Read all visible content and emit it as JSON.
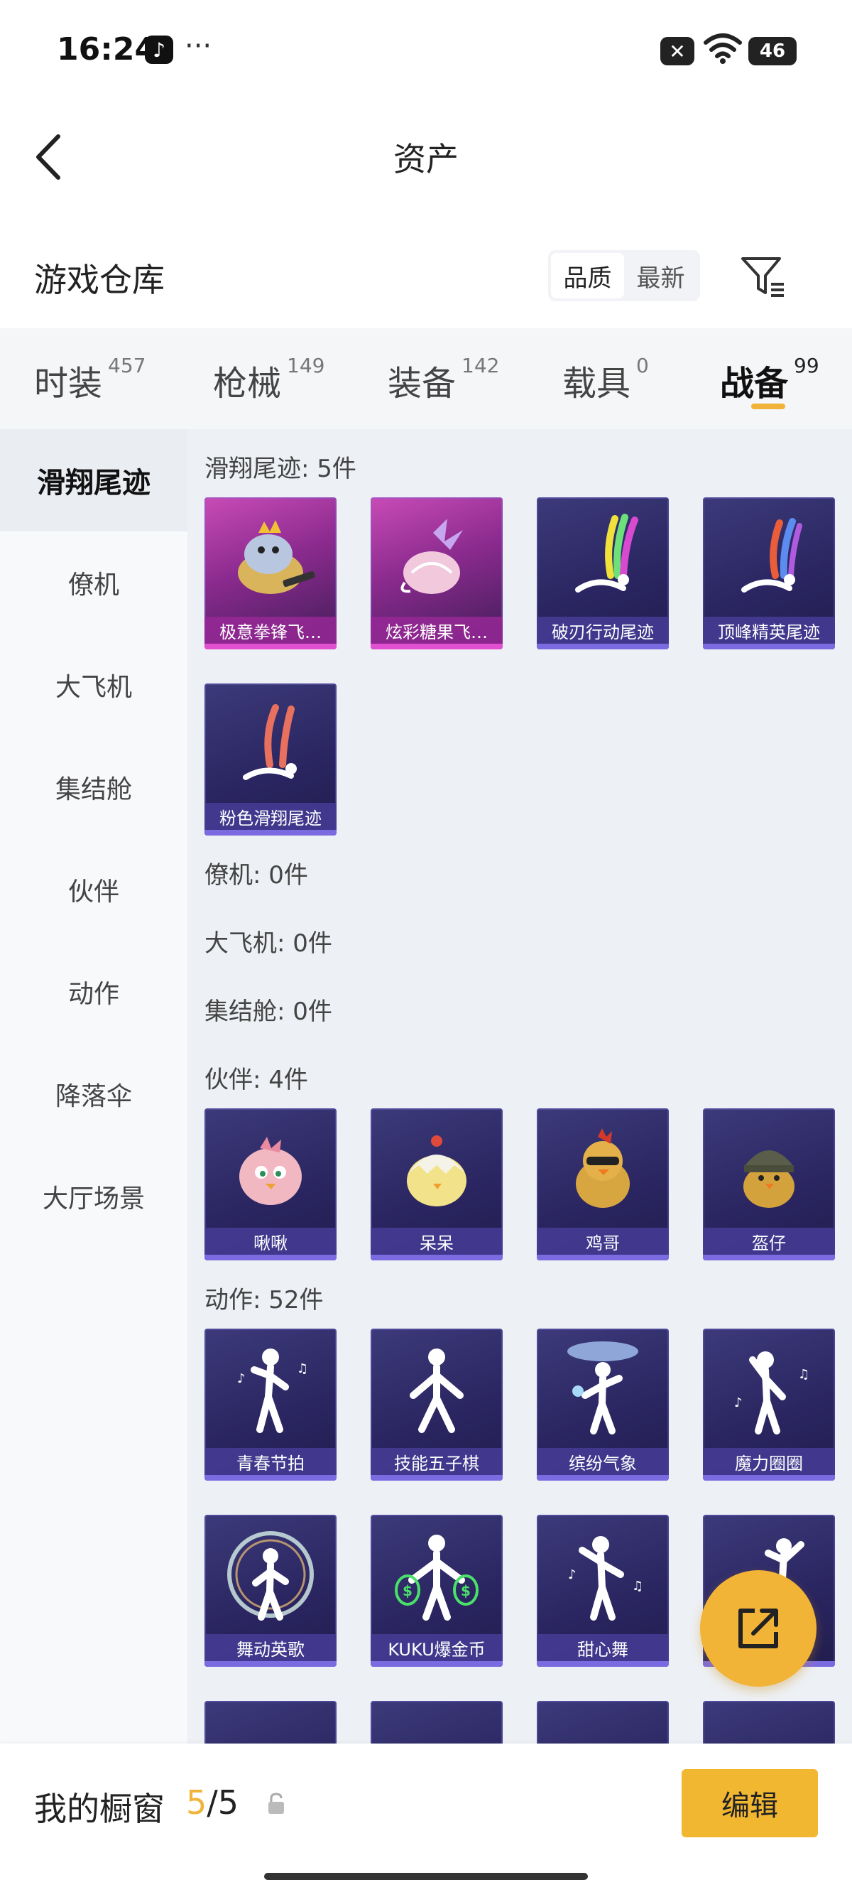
{
  "status": {
    "time": "16:24",
    "battery": "46"
  },
  "header": {
    "title": "资产"
  },
  "warehouse": {
    "title": "游戏仓库",
    "sort_options": [
      "品质",
      "最新"
    ],
    "selected_sort": "品质"
  },
  "tabs": [
    {
      "label": "时装",
      "count": "457"
    },
    {
      "label": "枪械",
      "count": "149"
    },
    {
      "label": "装备",
      "count": "142"
    },
    {
      "label": "载具",
      "count": "0"
    },
    {
      "label": "战备",
      "count": "99",
      "active": true
    }
  ],
  "sidebar": {
    "items": [
      "滑翔尾迹",
      "僚机",
      "大飞机",
      "集结舱",
      "伙伴",
      "动作",
      "降落伞",
      "大厅场景"
    ],
    "selected": "滑翔尾迹"
  },
  "sections": {
    "glide": {
      "title": "滑翔尾迹: 5件",
      "items": [
        "极意拳锋飞…",
        "炫彩糖果飞…",
        "破刃行动尾迹",
        "顶峰精英尾迹",
        "粉色滑翔尾迹"
      ]
    },
    "wingman": {
      "title": "僚机: 0件"
    },
    "plane": {
      "title": "大飞机: 0件"
    },
    "pod": {
      "title": "集结舱: 0件"
    },
    "partner": {
      "title": "伙伴: 4件",
      "items": [
        "啾啾",
        "呆呆",
        "鸡哥",
        "盔仔"
      ]
    },
    "emote": {
      "title": "动作: 52件",
      "items": [
        "青春节拍",
        "技能五子棋",
        "缤纷气象",
        "魔力圈圈",
        "舞动英歌",
        "KUKU爆金币",
        "甜心舞"
      ]
    }
  },
  "bottom": {
    "label": "我的橱窗",
    "count_current": "5",
    "count_total": "/5",
    "edit_label": "编辑"
  },
  "colors": {
    "accent": "#f0b43a",
    "card_purple": "#2a2560",
    "card_pink": "#c84bb6"
  }
}
